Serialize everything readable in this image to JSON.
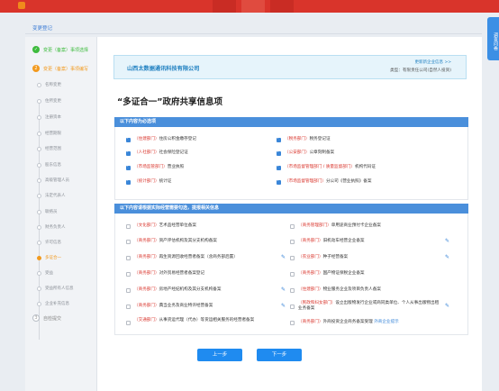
{
  "colors": {
    "accent": "#1f8bf0",
    "done": "#3dbb3d",
    "current": "#f29a1f",
    "required": "#d9342b"
  },
  "help_tab": "调查问卷",
  "breadcrumb": "变更登记",
  "sidebar": {
    "steps": [
      {
        "label": "变更（备案）事项选择",
        "state": "done",
        "icon": "check-icon"
      },
      {
        "label": "变更（备案）事项编写",
        "state": "current",
        "icon": "number-2-icon",
        "num": "2"
      },
      {
        "label": "自检提交",
        "state": "todo",
        "icon": "number-3-icon",
        "num": "3"
      }
    ],
    "subitems": [
      "名称变更",
      "住所变更",
      "注册资本",
      "经营期限",
      "经营范围",
      "股东信息",
      "高级管理人员",
      "法定代表人",
      "联络员",
      "财务负责人",
      "许可信息",
      "多证合一",
      "受益",
      "受益所有人信息",
      "企业补充信息"
    ],
    "active_subitem": 11
  },
  "company": {
    "name": "山西太数据通讯科技有限公司",
    "link": "更新新企业信息 >>",
    "type": "类型：有限责任公司(自然人投资)"
  },
  "section_title": "“多证合一”政府共享信息项",
  "required_band": "以下内容为必选项",
  "required_items": [
    {
      "dept": "（住建部门）",
      "text": "住房公积金缴存登记",
      "checked": true
    },
    {
      "dept": "（税务部门）",
      "text": "税务登记证",
      "checked": true
    },
    {
      "dept": "（人社部门）",
      "text": "社会保险登记证",
      "checked": true
    },
    {
      "dept": "（公安部门）",
      "text": "公章刻制备案",
      "checked": true
    },
    {
      "dept": "（市场监管部门）",
      "text": "营业执照",
      "checked": true
    },
    {
      "dept": "（市场监督管理部门 / 质量监督部门）",
      "text": "机构代码证",
      "checked": true
    },
    {
      "dept": "（统计部门）",
      "text": "统计证",
      "checked": true
    },
    {
      "dept": "（市场监督管理部门）",
      "text": "分公司《营业执照》备案",
      "checked": true
    }
  ],
  "optional_band": "以下内容请根据实际经营需要勾选，提报相关信息",
  "optional_items": [
    {
      "dept": "（文化部门）",
      "text": "艺术品经营单位备案",
      "edit": false
    },
    {
      "dept": "（商务管理部门）",
      "text": "单用途商业预付卡企业备案",
      "edit": false
    },
    {
      "dept": "（商务部门）",
      "text": "资产评估机构及其分支机构备案",
      "edit": false
    },
    {
      "dept": "（商务部门）",
      "text": "旧机动车经营企业备案",
      "edit": true
    },
    {
      "dept": "（商务部门）",
      "text": "再生资源回收经营者备案（含商务部后置）",
      "edit": true
    },
    {
      "dept": "（农业部门）",
      "text": "种子经营备案",
      "edit": true
    },
    {
      "dept": "（商务部门）",
      "text": "对外贸易经营者备案登记",
      "edit": false
    },
    {
      "dept": "（商务部门）",
      "text": "国产物证保税企业备案",
      "edit": false
    },
    {
      "dept": "（商务部门）",
      "text": "房地产经纪机构及其分支机构备案",
      "edit": true
    },
    {
      "dept": "（住建部门）",
      "text": "物业服务企业及项目负责人备案",
      "edit": false
    },
    {
      "dept": "（商务部门）",
      "text": "典当业务及商业特许经营备案",
      "edit": true
    },
    {
      "dept": "（民政和妇女部门）",
      "text": "设立出版物发行企业或商同类单位、个人从事出版物出租业务备案",
      "edit": true
    },
    {
      "dept": "（交通部门）",
      "text": "从事货运代理（代办）等货运相关服务的经营者备案",
      "edit": false
    },
    {
      "dept": "（商务部门）",
      "text": "外商投资企业商务备案受理",
      "extra": "外商企业提示",
      "edit": false
    }
  ],
  "buttons": {
    "prev": "上一步",
    "next": "下一步"
  }
}
